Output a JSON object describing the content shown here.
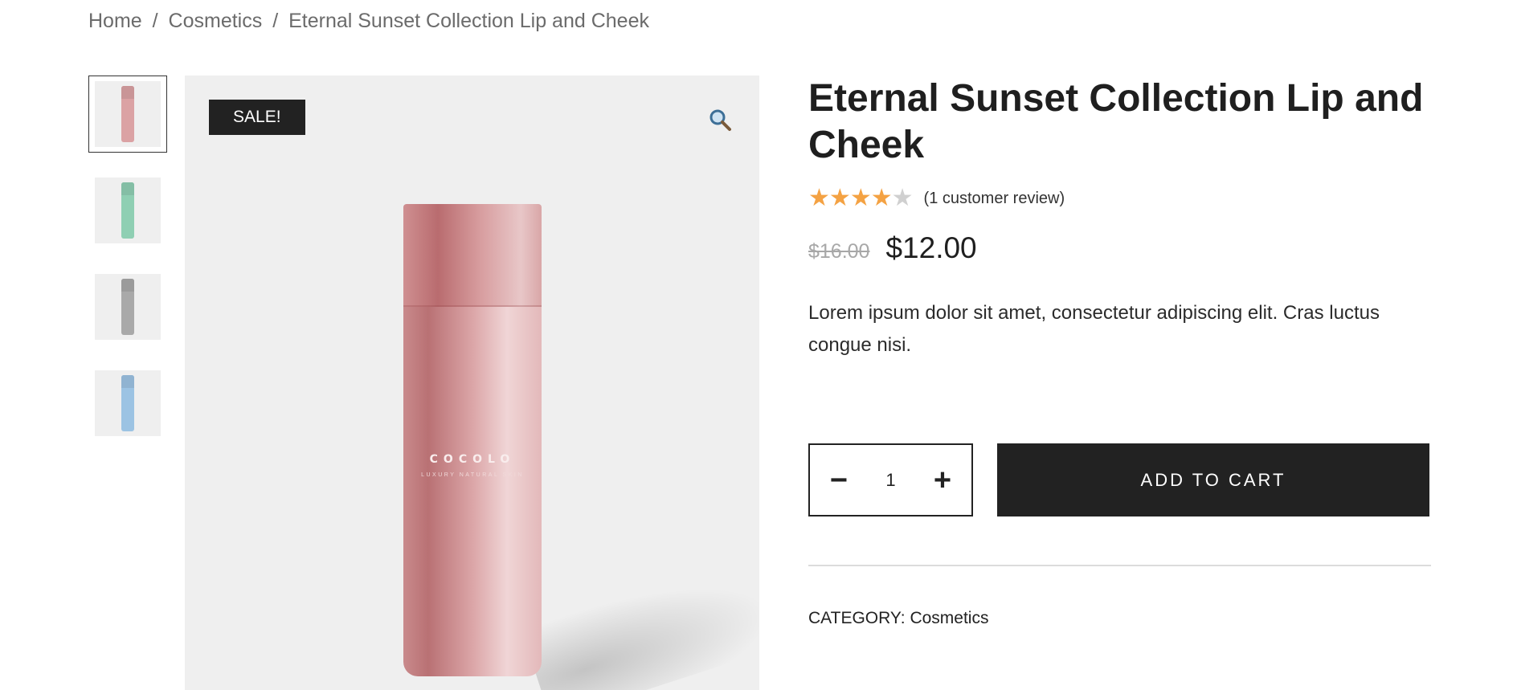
{
  "breadcrumb": {
    "home": "Home",
    "separator": "/",
    "category": "Cosmetics",
    "current": "Eternal Sunset Collection Lip and Cheek"
  },
  "gallery": {
    "sale_badge": "SALE!",
    "zoom_icon": "magnifier-icon",
    "bottle_brand": "COCOLO",
    "bottle_tagline": "LUXURY NATURAL SKIN",
    "thumbnails": [
      {
        "color": "#dba2a4",
        "active": true
      },
      {
        "color": "#8fcfb3",
        "active": false
      },
      {
        "color": "#a9a9a9",
        "active": false
      },
      {
        "color": "#9cc3e3",
        "active": false
      }
    ]
  },
  "product": {
    "title": "Eternal Sunset Collection Lip and Cheek",
    "rating": 4,
    "rating_max": 5,
    "review_text": "(1 customer review)",
    "old_price": "$16.00",
    "price": "$12.00",
    "description": "Lorem ipsum dolor sit amet, consectetur adipiscing elit. Cras luctus congue nisi."
  },
  "cart": {
    "minus_label": "−",
    "quantity": "1",
    "plus_label": "+",
    "add_label": "ADD TO CART"
  },
  "meta": {
    "category_label": "CATEGORY:",
    "category_value": "Cosmetics"
  },
  "colors": {
    "accent_dark": "#222222",
    "star": "#f4a243"
  }
}
